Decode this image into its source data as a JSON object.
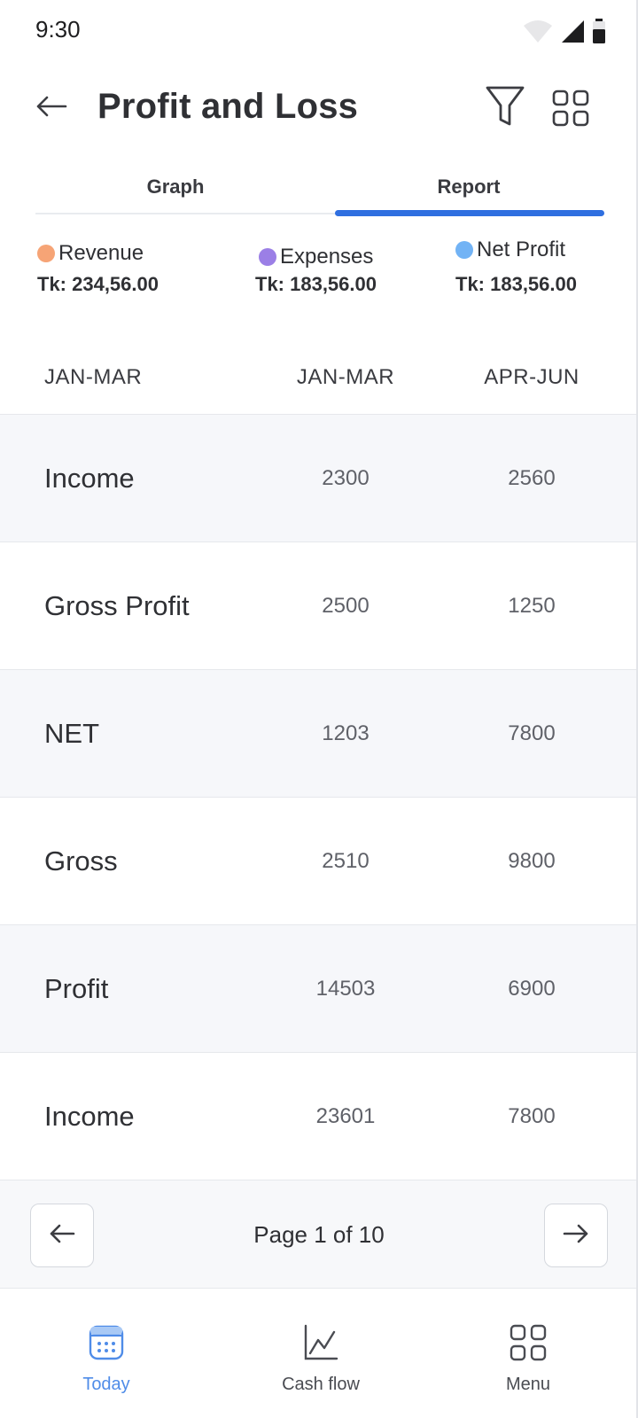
{
  "status_bar": {
    "time": "9:30",
    "icons": [
      "wifi-icon",
      "signal-icon",
      "battery-icon"
    ]
  },
  "header": {
    "title": "Profit and Loss",
    "back_icon": "arrow-left-icon",
    "filter_icon": "filter-icon",
    "grid_icon": "grid-icon"
  },
  "tabs": [
    {
      "label": "Graph",
      "active": false
    },
    {
      "label": "Report",
      "active": true
    }
  ],
  "legend": [
    {
      "label": "Revenue",
      "value": "Tk: 234,56.00",
      "color": "#f6a476"
    },
    {
      "label": "Expenses",
      "value": "Tk: 183,56.00",
      "color": "#9b7fe6"
    },
    {
      "label": "Net Profit",
      "value": "Tk: 183,56.00",
      "color": "#72b3f5"
    }
  ],
  "table": {
    "columns": [
      "JAN-MAR",
      "JAN-MAR",
      "APR-JUN"
    ],
    "rows": [
      {
        "label": "Income",
        "v1": "2300",
        "v2": "2560"
      },
      {
        "label": "Gross Profit",
        "v1": "2500",
        "v2": "1250"
      },
      {
        "label": "NET",
        "v1": "1203",
        "v2": "7800"
      },
      {
        "label": "Gross",
        "v1": "2510",
        "v2": "9800"
      },
      {
        "label": "Profit",
        "v1": "14503",
        "v2": "6900"
      },
      {
        "label": "Income",
        "v1": "23601",
        "v2": "7800"
      }
    ]
  },
  "pagination": {
    "text": "Page 1 of 10",
    "prev_icon": "arrow-left-icon",
    "next_icon": "arrow-right-icon"
  },
  "bottom_nav": [
    {
      "label": "Today",
      "icon": "calendar-icon",
      "active": true
    },
    {
      "label": "Cash flow",
      "icon": "chart-line-icon",
      "active": false
    },
    {
      "label": "Menu",
      "icon": "grid-icon",
      "active": false
    }
  ],
  "colors": {
    "accent": "#2f6fe0",
    "active_nav": "#4f8ce8"
  }
}
